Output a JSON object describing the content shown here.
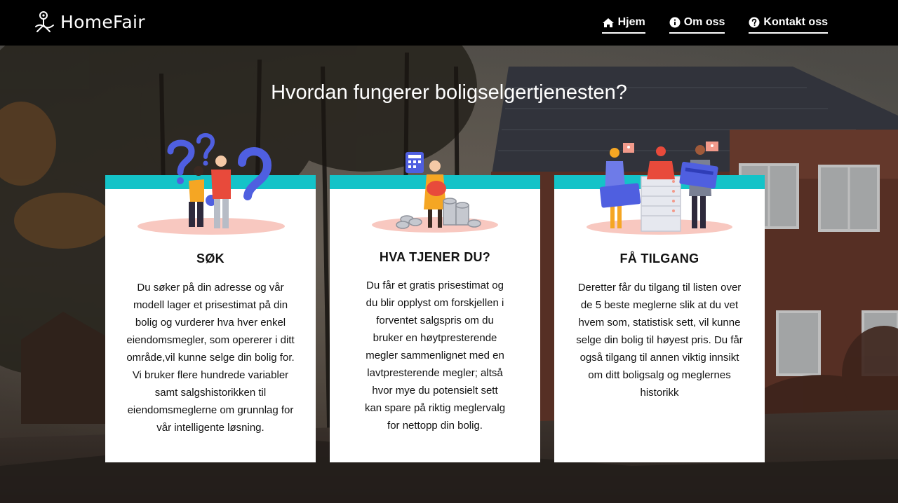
{
  "brand": {
    "name": "HomeFair",
    "logo_icon": "location-pin-hand-icon"
  },
  "nav": {
    "items": [
      {
        "label": "Hjem",
        "icon": "home-icon"
      },
      {
        "label": "Om oss",
        "icon": "info-circle-icon"
      },
      {
        "label": "Kontakt oss",
        "icon": "question-circle-icon"
      }
    ]
  },
  "main": {
    "headline": "Hvordan fungerer boligselgertjenesten?"
  },
  "cards": [
    {
      "title": "SØK",
      "illustration": "people-question-marks-illustration",
      "lines": [
        "Du søker på din adresse og vår",
        "modell lager et prisestimat på din",
        "bolig og vurderer hva hver enkel",
        "eiendomsmegler, som opererer i ditt",
        "område,vil kunne selge din bolig for.",
        "Vi bruker flere hundrede variabler",
        "samt salgshistorikken til",
        "eiendomsmeglerne om grunnlag for",
        "vår intelligente løsning."
      ]
    },
    {
      "title": "HVA TJENER DU?",
      "illustration": "woman-piggy-bank-coins-illustration",
      "lines": [
        "Du får et gratis prisestimat og",
        "du blir opplyst om forskjellen i",
        "forventet salgspris om du",
        "bruker en høytpresterende",
        "megler sammenlignet med en",
        "lavtpresterende megler; altså",
        "hvor mye du potensielt sett",
        "kan spare på riktig meglervalg",
        "for nettopp din bolig."
      ]
    },
    {
      "title": "FÅ TILGANG",
      "illustration": "people-server-cards-illustration",
      "lines": [
        "Deretter får du tilgang til listen over",
        "de 5 beste meglerne slik at du vet",
        "hvem som, statistisk sett, vil kunne",
        "selge din bolig til høyest pris. Du får",
        "også tilgang til annen viktig innsikt",
        "om ditt boligsalg og meglernes",
        "historikk"
      ]
    }
  ],
  "colors": {
    "nav_bg": "#000000",
    "card_accent": "#14c3c8",
    "card_bg": "#ffffff",
    "illustration_blue": "#4f5fe0",
    "illustration_orange": "#f5a623",
    "illustration_red": "#e84a3b",
    "illustration_pink": "#f8c8c0"
  }
}
